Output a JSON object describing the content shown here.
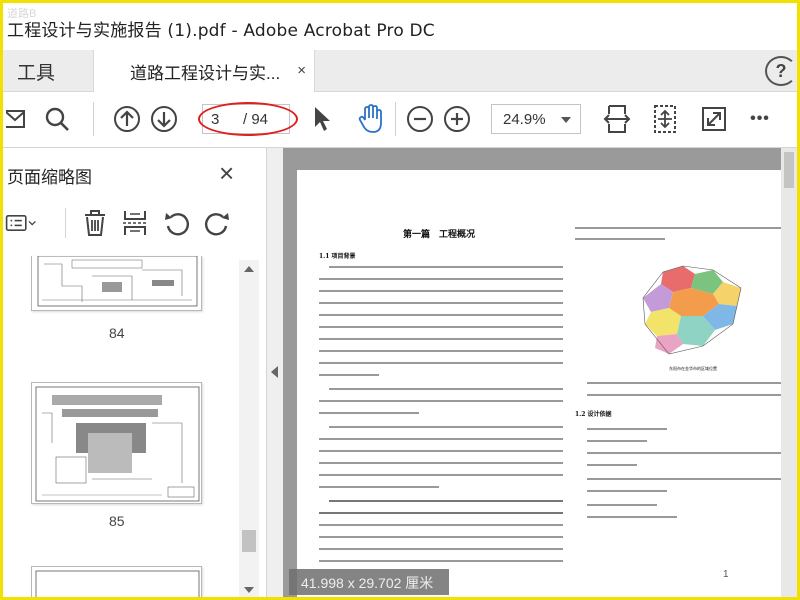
{
  "window": {
    "title": "工程设计与实施报告 (1).pdf - Adobe Acrobat Pro DC",
    "watermark": "道路B"
  },
  "tabs": {
    "tools": "工具",
    "document": "道路工程设计与实...",
    "close": "×",
    "help": "?"
  },
  "toolbar": {
    "current_page": "3",
    "total_pages": "/ 94",
    "zoom": "24.9%",
    "more": "•••"
  },
  "thumbnail_panel": {
    "title": "页面缩略图",
    "close": "×",
    "thumbnails": [
      {
        "label": "84"
      },
      {
        "label": "85"
      }
    ]
  },
  "document_page": {
    "heading": "第一篇　工程概况",
    "section_1_1": "1.1 项目背景",
    "section_1_2": "1.2 设计依据",
    "map_caption": "东阳市在金华市的区域位置",
    "page_number": "1"
  },
  "status": {
    "page_size": "41.998 x 29.702 厘米"
  },
  "colors": {
    "accent_frame": "#f2e100",
    "highlight_ellipse": "#e02020"
  }
}
